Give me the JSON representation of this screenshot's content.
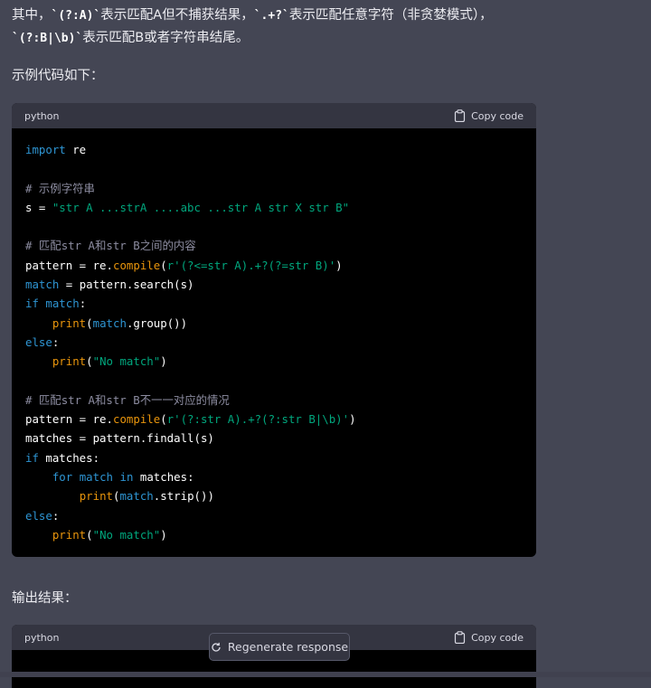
{
  "intro": {
    "line1_a": "其中，",
    "line1_code1": "`(?:A)`",
    "line1_b": "表示匹配A但不捕获结果，",
    "line1_code2": "`.+?`",
    "line1_c": "表示匹配任意字符（非贪婪模式），",
    "line2_code": "`(?:B|\\b)`",
    "line2_b": "表示匹配B或者字符串结尾。"
  },
  "example_label": "示例代码如下：",
  "code_block_1": {
    "language": "python",
    "copy_label": "Copy code",
    "lines": {
      "l1_kw": "import",
      "l1_rest": " re",
      "l3_comment": "# 示例字符串",
      "l4_pre": "s = ",
      "l4_str": "\"str A ...strA ....abc ...str A str X str B\"",
      "l6_comment": "# 匹配str A和str B之间的内容",
      "l7_pre": "pattern = re.",
      "l7_fn": "compile",
      "l7_open": "(",
      "l7_str": "r'(?<=str A).+?(?=str B)'",
      "l7_close": ")",
      "l8_kw": "match",
      "l8_rest": " = pattern.search(s)",
      "l9_kw": "if",
      "l9_sp": " ",
      "l9_kw2": "match",
      "l9_rest": ":",
      "l10_indent": "    ",
      "l10_fn": "print",
      "l10_open": "(",
      "l10_kw": "match",
      "l10_rest": ".group())",
      "l11_kw": "else",
      "l11_rest": ":",
      "l12_indent": "    ",
      "l12_fn": "print",
      "l12_open": "(",
      "l12_str": "\"No match\"",
      "l12_close": ")",
      "l14_comment": "# 匹配str A和str B不一一对应的情况",
      "l15_pre": "pattern = re.",
      "l15_fn": "compile",
      "l15_open": "(",
      "l15_str": "r'(?:str A).+?(?:str B|\\b)'",
      "l15_close": ")",
      "l16_rest": "matches = pattern.findall(s)",
      "l17_kw": "if",
      "l17_rest": " matches:",
      "l18_indent": "    ",
      "l18_kw": "for",
      "l18_sp": " ",
      "l18_kw2": "match",
      "l18_sp2": " ",
      "l18_kw3": "in",
      "l18_rest": " matches:",
      "l19_indent": "        ",
      "l19_fn": "print",
      "l19_open": "(",
      "l19_kw": "match",
      "l19_rest": ".strip())",
      "l20_kw": "else",
      "l20_rest": ":",
      "l21_indent": "    ",
      "l21_fn": "print",
      "l21_open": "(",
      "l21_str": "\"No match\"",
      "l21_close": ")"
    }
  },
  "output_label": "输出结果：",
  "code_block_2": {
    "language": "python",
    "copy_label": "Copy code"
  },
  "regenerate_label": "Regenerate response",
  "icons": {
    "copy": "clipboard-icon",
    "regenerate": "refresh-icon"
  },
  "colors": {
    "background": "#444654",
    "code_bg": "#000000",
    "code_header": "#343541",
    "keyword": "#2e95d3",
    "builtin": "#e9950c",
    "string": "#00a67d",
    "comment": "#8c8ca0"
  }
}
